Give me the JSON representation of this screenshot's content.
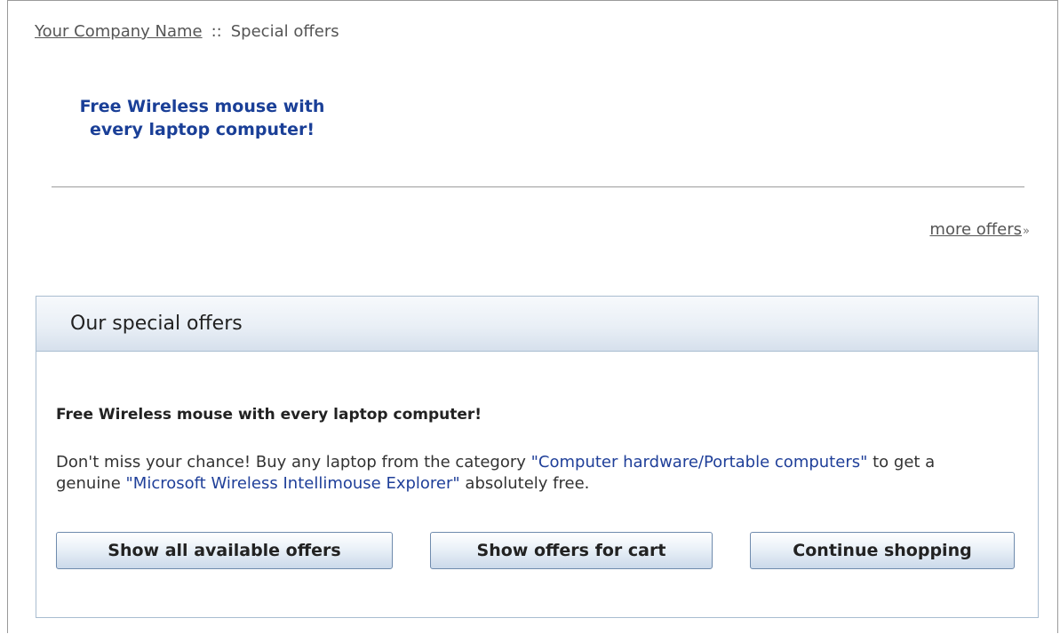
{
  "breadcrumb": {
    "home": "Your Company Name",
    "separator": "::",
    "current": "Special offers"
  },
  "promo": {
    "line1": "Free Wireless mouse with",
    "line2": "every laptop computer!"
  },
  "more_offers": {
    "label": "more offers",
    "arrows": "»"
  },
  "panel": {
    "title": "Our special offers",
    "offer_title": "Free Wireless mouse with every laptop computer!",
    "text_part1": "Don't miss your chance! Buy any laptop from the category ",
    "category_link": "\"Computer hardware/Portable computers\"",
    "text_part2": " to get a genuine ",
    "product_link": "\"Microsoft Wireless Intellimouse Explorer\"",
    "text_part3": " absolutely free."
  },
  "buttons": {
    "show_all": "Show all available offers",
    "show_cart": "Show offers for cart",
    "continue": "Continue shopping"
  },
  "colors": {
    "link_blue": "#1f3f99",
    "promo_blue": "#1a3f97",
    "panel_border": "#a9bdd0"
  }
}
